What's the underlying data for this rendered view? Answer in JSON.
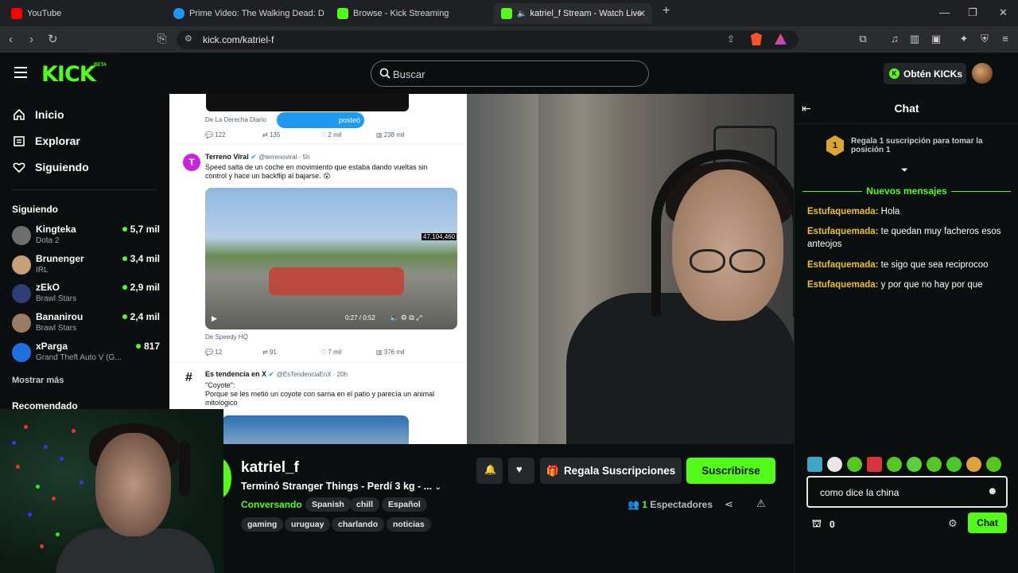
{
  "browser": {
    "tabs": [
      {
        "title": "YouTube",
        "color": "#ff0000"
      },
      {
        "title": "Prime Video: The Walking Dead: Dea",
        "color": "#1a98ff"
      },
      {
        "title": "Browse - Kick Streaming",
        "color": "#53fc18"
      },
      {
        "title": "katriel_f Stream - Watch Live",
        "color": "#53fc18",
        "active": true
      }
    ],
    "url": "kick.com/katriel-f"
  },
  "header": {
    "logo": "KICK",
    "beta": "BETA",
    "search_placeholder": "Buscar",
    "kicks_label": "Obtén KICKs"
  },
  "sidebar": {
    "nav": [
      {
        "label": "Inicio",
        "icon": "home-icon"
      },
      {
        "label": "Explorar",
        "icon": "compass-icon"
      },
      {
        "label": "Siguiendo",
        "icon": "heart-icon"
      }
    ],
    "following_title": "Siguiendo",
    "following": [
      {
        "name": "Kingteka",
        "category": "Dota 2",
        "viewers": "5,7 mil",
        "avatar_color": "#6e6e6e"
      },
      {
        "name": "Brunenger",
        "category": "IRL",
        "viewers": "3,4 mil",
        "avatar_color": "#c7a07a"
      },
      {
        "name": "zEkO",
        "category": "Brawl Stars",
        "viewers": "2,9 mil",
        "avatar_color": "#2c3e73"
      },
      {
        "name": "Bananirou",
        "category": "Brawl Stars",
        "viewers": "2,4 mil",
        "avatar_color": "#9a7b64"
      },
      {
        "name": "xParga",
        "category": "Grand Theft Auto V (G...",
        "viewers": "817",
        "avatar_color": "#1f6fe0"
      }
    ],
    "show_more": "Mostrar más",
    "recommended_title": "Recomendado"
  },
  "video_tweets": {
    "tweet1_source": "De La Derecha Diario",
    "posted_pill": "posteó",
    "tweet1_stats": [
      "122",
      "135",
      "2 mil",
      "238 mil"
    ],
    "tweet2_author": "Terreno Viral",
    "tweet2_handle": "@terrenoviral · 5h",
    "tweet2_text": "Speed salta de un coche en movimiento que estaba dando vueltas sin control y hace un backflip al bajarse. 😮",
    "tweet2_video_time": "0:27 / 0:52",
    "tweet2_counter": "47,104,460",
    "tweet2_source": "De Speedy HQ",
    "tweet2_stats": [
      "12",
      "91",
      "7 mil",
      "376 mil"
    ],
    "tweet3_author": "Es tendencia en X",
    "tweet3_handle": "@EsTendenciaEnX · 20h",
    "tweet3_text": "\"Coyote\":\nPorque se les metió un coyote con sarna en el patio y parecía un animal mitológico"
  },
  "stream": {
    "streamer": "katriel_f",
    "title": "Terminó Stranger Things - Perdí 3 kg - ...",
    "category": "Conversando",
    "tags_row1": [
      "Spanish",
      "chill",
      "Español"
    ],
    "tags_row2": [
      "gaming",
      "uruguay",
      "charlando",
      "noticias"
    ],
    "gift_label": "Regala Suscripciones",
    "subscribe_label": "Suscribirse",
    "viewers_count": "1",
    "viewers_label": "Espectadores"
  },
  "chat": {
    "title": "Chat",
    "gift_rank_number": "1",
    "gift_rank_text": "Regala 1 suscripción para tomar la posición 1",
    "new_messages": "Nuevos mensajes",
    "messages": [
      {
        "user": "Estufaquemada:",
        "text": "Hola"
      },
      {
        "user": "Estufaquemada:",
        "text": "te quedan muy facheros esos anteojos"
      },
      {
        "user": "Estufaquemada:",
        "text": "te sigo que sea reciprocoo"
      },
      {
        "user": "Estufaquemada:",
        "text": "y por que no hay por que"
      }
    ],
    "input_value": "como dice la china ",
    "points": "0",
    "send_label": "Chat"
  }
}
